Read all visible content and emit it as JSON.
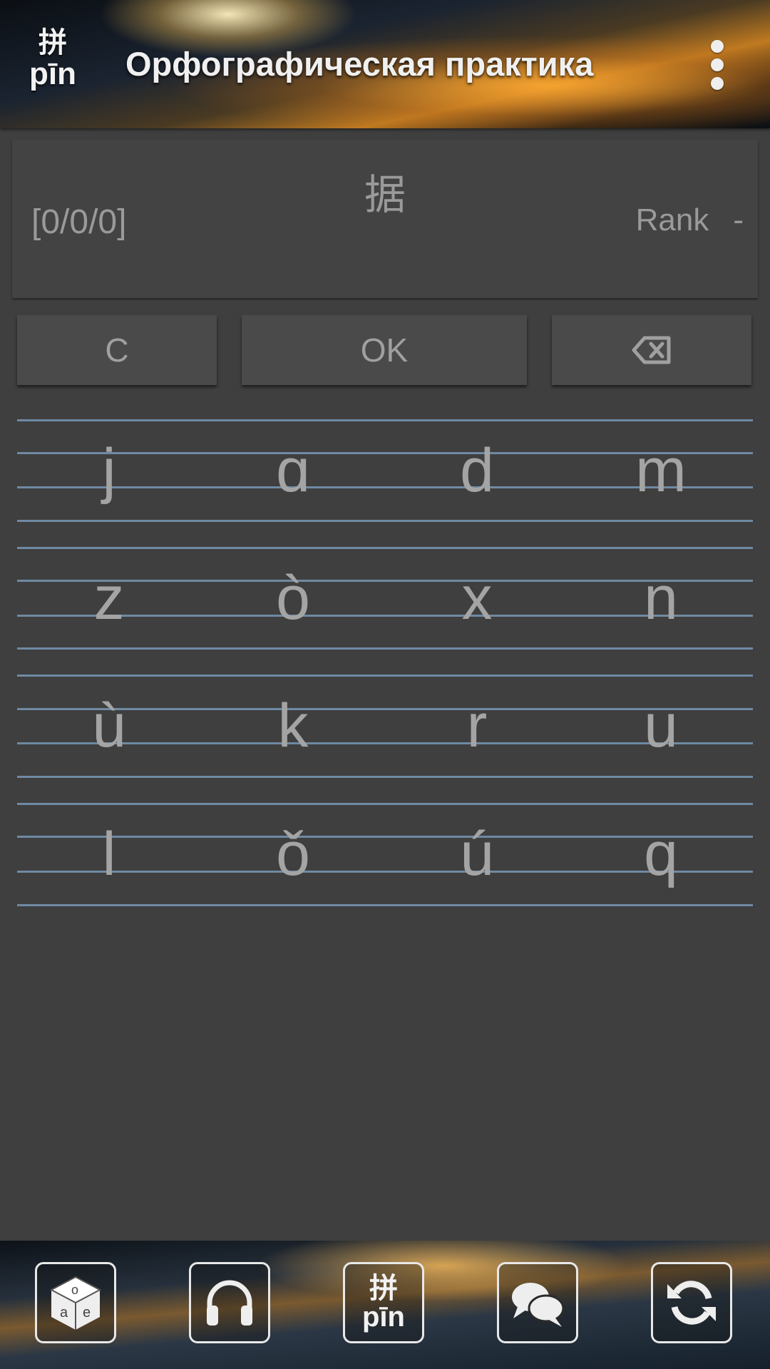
{
  "app": {
    "title": "Орфографическая практика",
    "logo_han": "拼",
    "logo_latin": "pīn"
  },
  "card": {
    "character": "据",
    "score": "[0/0/0]",
    "rank_label": "Rank",
    "rank_value": "-"
  },
  "controls": {
    "clear_label": "C",
    "ok_label": "OK",
    "backspace_icon": "backspace-icon"
  },
  "keyboard": {
    "rows": [
      [
        "j",
        "ɑ",
        "d",
        "m"
      ],
      [
        "z",
        "ò",
        "x",
        "n"
      ],
      [
        "ù",
        "k",
        "r",
        "u"
      ],
      [
        "l",
        "ǒ",
        "ú",
        "q"
      ]
    ]
  },
  "bottom_nav": {
    "items": [
      {
        "icon": "dice-icon"
      },
      {
        "icon": "headphones-icon"
      },
      {
        "icon": "pinyin-logo-icon",
        "han": "拼",
        "latin": "pīn"
      },
      {
        "icon": "chat-bubbles-icon"
      },
      {
        "icon": "refresh-icon"
      }
    ]
  },
  "colors": {
    "background": "#3f3f3f",
    "card": "#434343",
    "button": "#4a4a4a",
    "line": "#6f8aa3",
    "text": "#9a9a9a"
  }
}
